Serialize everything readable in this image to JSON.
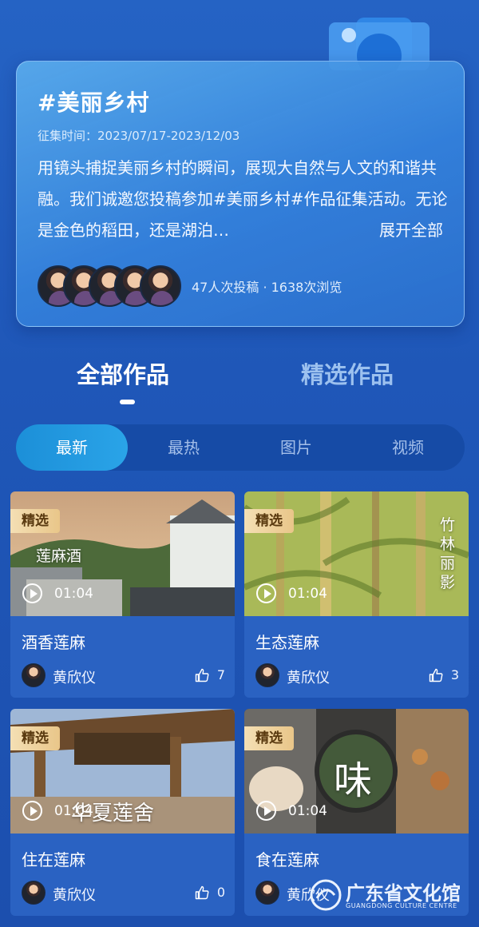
{
  "topic": {
    "title": "#美丽乡村",
    "period": "征集时间：2023/07/17-2023/12/03",
    "description": "用镜头捕捉美丽乡村的瞬间，展现大自然与人文的和谐共融。我们诚邀您投稿参加#美丽乡村#作品征集活动。无论是金色的稻田，还是湖泊…",
    "expand_label": "展开全部",
    "stats": "47人次投稿 · 1638次浏览"
  },
  "main_tabs": [
    {
      "label": "全部作品",
      "active": true
    },
    {
      "label": "精选作品",
      "active": false
    }
  ],
  "filters": [
    "最新",
    "最热",
    "图片",
    "视频"
  ],
  "works": [
    {
      "badge": "精选",
      "duration": "01:04",
      "title": "酒香莲麻",
      "author": "黄欣仪",
      "likes": "7",
      "overlay": "莲麻酒",
      "scene": "village"
    },
    {
      "badge": "精选",
      "duration": "01:04",
      "title": "生态莲麻",
      "author": "黄欣仪",
      "likes": "3",
      "overlay": "竹林丽影",
      "scene": "bamboo"
    },
    {
      "badge": "精选",
      "duration": "01:04",
      "title": "住在莲麻",
      "author": "黄欣仪",
      "likes": "0",
      "overlay": "华夏莲舍",
      "scene": "gate"
    },
    {
      "badge": "精选",
      "duration": "01:04",
      "title": "食在莲麻",
      "author": "黄欣仪",
      "likes": "",
      "overlay": "味",
      "scene": "food"
    }
  ],
  "watermark": {
    "name": "广东省文化馆",
    "sub": "GUANGDONG CULTURE CENTRE"
  },
  "colors": {
    "background": "#2160c0",
    "badge": "#efd4a0",
    "filter_active": "#24a0e6"
  }
}
